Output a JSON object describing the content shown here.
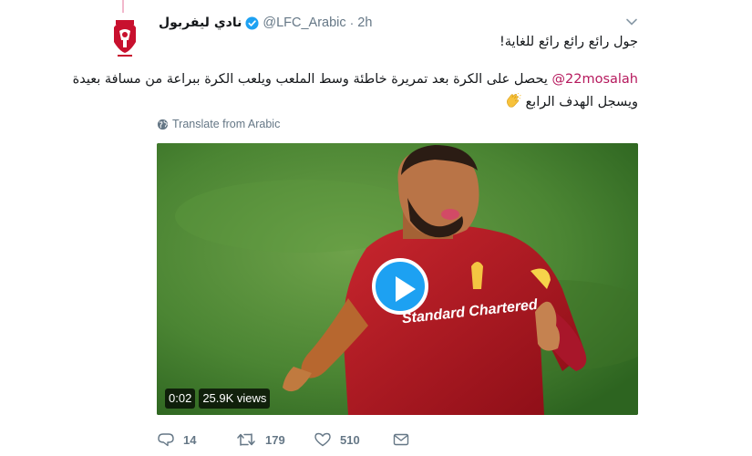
{
  "tweet": {
    "display_name": "نادي ليفربول",
    "handle": "@LFC_Arabic",
    "separator": "·",
    "time": "2h",
    "line1": "جول رائع رائع رائع للغاية!",
    "mention": "@22mosalah",
    "line2_rest": " يحصل على الكرة بعد تمريرة خاطئة وسط الملعب ويلعب الكرة ببراعة من مسافة بعيدة",
    "line3": "ويسجل الهدف الرابع ",
    "translate_label": "Translate from Arabic"
  },
  "video": {
    "duration": "0:02",
    "views": "25.9K views",
    "sleeve_text": "Standard Chartered"
  },
  "actions": {
    "replies": "14",
    "retweets": "179",
    "likes": "510"
  },
  "colors": {
    "link": "#b6195d",
    "play": "#1da1f2",
    "muted": "#657786",
    "lfc_red": "#c8102e"
  },
  "icons": [
    "liverpool-crest-icon",
    "verified-badge-icon",
    "chevron-down-icon",
    "clapping-hands-icon",
    "globe-icon",
    "play-icon",
    "reply-icon",
    "retweet-icon",
    "like-icon",
    "direct-message-icon"
  ]
}
